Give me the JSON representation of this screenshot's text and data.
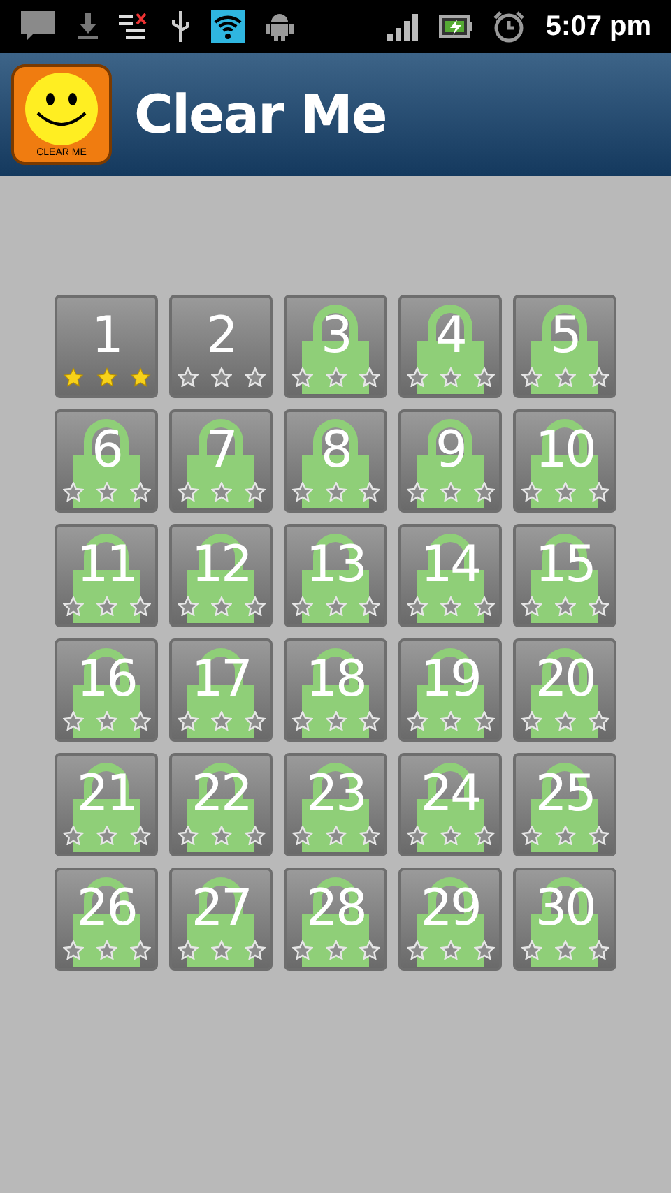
{
  "status_bar": {
    "time": "5:07 pm"
  },
  "app_bar": {
    "logo_caption": "CLEAR ME",
    "title": "Clear Me"
  },
  "levels": [
    {
      "number": "1",
      "locked": false,
      "stars": 3
    },
    {
      "number": "2",
      "locked": false,
      "stars": 0
    },
    {
      "number": "3",
      "locked": true,
      "stars": 0
    },
    {
      "number": "4",
      "locked": true,
      "stars": 0
    },
    {
      "number": "5",
      "locked": true,
      "stars": 0
    },
    {
      "number": "6",
      "locked": true,
      "stars": 0
    },
    {
      "number": "7",
      "locked": true,
      "stars": 0
    },
    {
      "number": "8",
      "locked": true,
      "stars": 0
    },
    {
      "number": "9",
      "locked": true,
      "stars": 0
    },
    {
      "number": "10",
      "locked": true,
      "stars": 0
    },
    {
      "number": "11",
      "locked": true,
      "stars": 0
    },
    {
      "number": "12",
      "locked": true,
      "stars": 0
    },
    {
      "number": "13",
      "locked": true,
      "stars": 0
    },
    {
      "number": "14",
      "locked": true,
      "stars": 0
    },
    {
      "number": "15",
      "locked": true,
      "stars": 0
    },
    {
      "number": "16",
      "locked": true,
      "stars": 0
    },
    {
      "number": "17",
      "locked": true,
      "stars": 0
    },
    {
      "number": "18",
      "locked": true,
      "stars": 0
    },
    {
      "number": "19",
      "locked": true,
      "stars": 0
    },
    {
      "number": "20",
      "locked": true,
      "stars": 0
    },
    {
      "number": "21",
      "locked": true,
      "stars": 0
    },
    {
      "number": "22",
      "locked": true,
      "stars": 0
    },
    {
      "number": "23",
      "locked": true,
      "stars": 0
    },
    {
      "number": "24",
      "locked": true,
      "stars": 0
    },
    {
      "number": "25",
      "locked": true,
      "stars": 0
    },
    {
      "number": "26",
      "locked": true,
      "stars": 0
    },
    {
      "number": "27",
      "locked": true,
      "stars": 0
    },
    {
      "number": "28",
      "locked": true,
      "stars": 0
    },
    {
      "number": "29",
      "locked": true,
      "stars": 0
    },
    {
      "number": "30",
      "locked": true,
      "stars": 0
    }
  ]
}
